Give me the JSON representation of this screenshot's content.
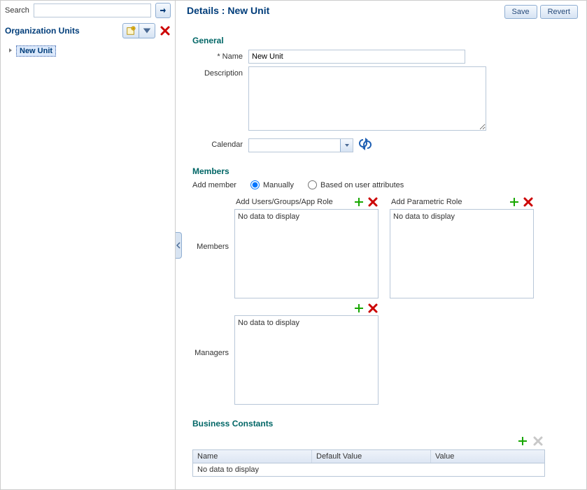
{
  "search": {
    "label": "Search",
    "value": "",
    "placeholder": ""
  },
  "sidebar": {
    "title": "Organization Units",
    "tree": {
      "node_label": "New Unit"
    }
  },
  "details": {
    "title_prefix": "Details : ",
    "title_item": "New Unit",
    "buttons": {
      "save": "Save",
      "revert": "Revert"
    },
    "general": {
      "heading": "General",
      "name_label": "Name",
      "name_value": "New Unit",
      "description_label": "Description",
      "description_value": "",
      "calendar_label": "Calendar",
      "calendar_value": ""
    },
    "members": {
      "heading": "Members",
      "add_member_label": "Add member",
      "option_manual": "Manually",
      "option_attr": "Based on user attributes",
      "members_label": "Members",
      "managers_label": "Managers",
      "users_caption": "Add Users/Groups/App Role",
      "parametric_caption": "Add Parametric Role",
      "empty": "No data to display"
    },
    "bc": {
      "heading": "Business Constants",
      "col_name": "Name",
      "col_default": "Default Value",
      "col_value": "Value",
      "empty": "No data to display"
    }
  }
}
